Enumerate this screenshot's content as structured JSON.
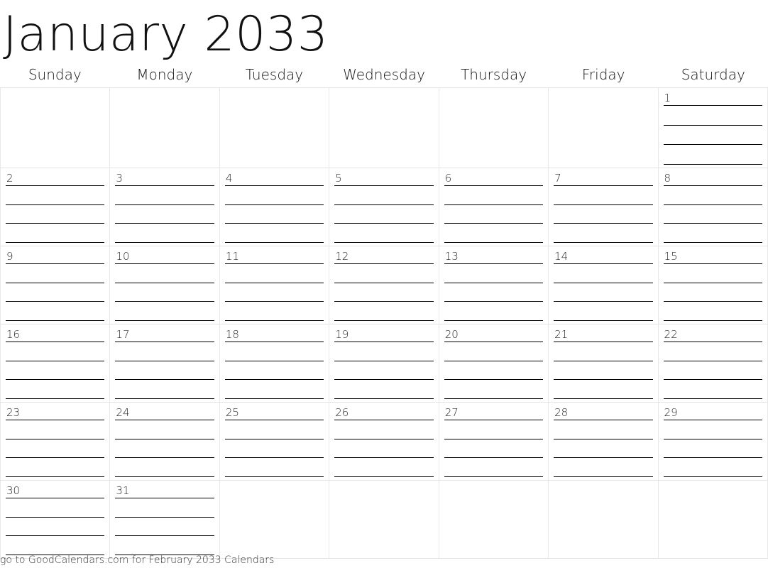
{
  "title": "January 2033",
  "weekdays": [
    "Sunday",
    "Monday",
    "Tuesday",
    "Wednesday",
    "Thursday",
    "Friday",
    "Saturday"
  ],
  "grid": {
    "rows": 6,
    "columns": 7,
    "lines_per_cell": 4,
    "weeks": [
      [
        "",
        "",
        "",
        "",
        "",
        "",
        "1"
      ],
      [
        "2",
        "3",
        "4",
        "5",
        "6",
        "7",
        "8"
      ],
      [
        "9",
        "10",
        "11",
        "12",
        "13",
        "14",
        "15"
      ],
      [
        "16",
        "17",
        "18",
        "19",
        "20",
        "21",
        "22"
      ],
      [
        "23",
        "24",
        "25",
        "26",
        "27",
        "28",
        "29"
      ],
      [
        "30",
        "31",
        "",
        "",
        "",
        "",
        ""
      ]
    ]
  },
  "footer": {
    "text": "go to GoodCalendars.com for February 2033 Calendars"
  },
  "colors": {
    "page_background": "#ffffff",
    "grid_border": "#e3e3e3",
    "rule_line": "#000000",
    "title_text": "#111111",
    "weekday_text": "#121212",
    "day_number_text": "#2a2a2a",
    "footer_text": "#333333"
  }
}
